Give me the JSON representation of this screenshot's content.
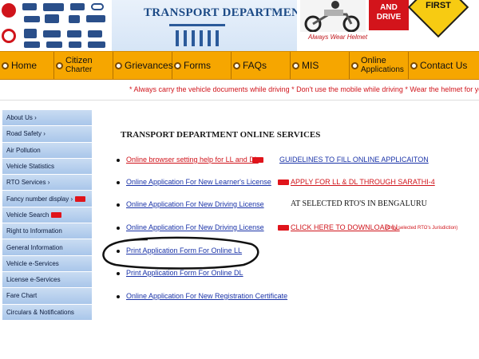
{
  "header": {
    "title": "TRANSPORT DEPARTMENT",
    "ad_tagline": "Always Wear Helmet",
    "ad_sign_1": [
      "AND",
      "DRIVE"
    ],
    "ad_sign_2": "FIRST"
  },
  "nav": {
    "items": [
      {
        "label": "Home"
      },
      {
        "label": "Citizen",
        "sub": "Charter"
      },
      {
        "label": "Grievances"
      },
      {
        "label": "Forms"
      },
      {
        "label": "FAQs"
      },
      {
        "label": "MIS"
      },
      {
        "label": "Online",
        "sub": "Applications"
      },
      {
        "label": "Contact Us"
      }
    ]
  },
  "marquee": {
    "text": "* Always carry the vehicle documents while driving * Don't use the mobile while driving * Wear the helmet for your safety * Ov"
  },
  "sidebar": {
    "items": [
      {
        "label": "About Us ›"
      },
      {
        "label": "Road Safety ›"
      },
      {
        "label": "Air Pollution"
      },
      {
        "label": "Vehicle Statistics"
      },
      {
        "label": "RTO Services ›"
      },
      {
        "label": "Fancy number display ›"
      },
      {
        "label": "Vehicle Search"
      },
      {
        "label": "Right to Information"
      },
      {
        "label": "General Information"
      },
      {
        "label": "Vehicle e-Services"
      },
      {
        "label": "License e-Services"
      },
      {
        "label": "Fare Chart"
      },
      {
        "label": "Circulars & Notifications"
      }
    ]
  },
  "content": {
    "title": "TRANSPORT DEPARTMENT ONLINE SERVICES",
    "links": [
      {
        "left": "Online browser setting help for LL and DL",
        "right": "GUIDELINES TO FILL ONLINE APPLICAITON"
      },
      {
        "left": "Online Application For New Learner's License",
        "right": "APPLY FOR LL & DL THROUGH SARATHI-4"
      },
      {
        "left": "Online Application For New Driving License",
        "right": "AT SELECTED RTO'S IN BENGALURU"
      },
      {
        "left": "Online Application For New Driving License",
        "right": "CLICK HERE TO DOWNLOAD LL",
        "right_note": "(Only selected RTO's Jurisdiction)"
      },
      {
        "left": "Print Application Form For Online LL"
      },
      {
        "left": "Print Application Form For Online DL"
      },
      {
        "left": "Online Application For New Registration Certificate"
      }
    ]
  },
  "colors": {
    "nav_bg": "#f6a600",
    "sidebar_bg": "#b7cfee",
    "link_blue": "#1a33a8",
    "alert_red": "#d0141b",
    "header_blue": "#1c4a86"
  }
}
